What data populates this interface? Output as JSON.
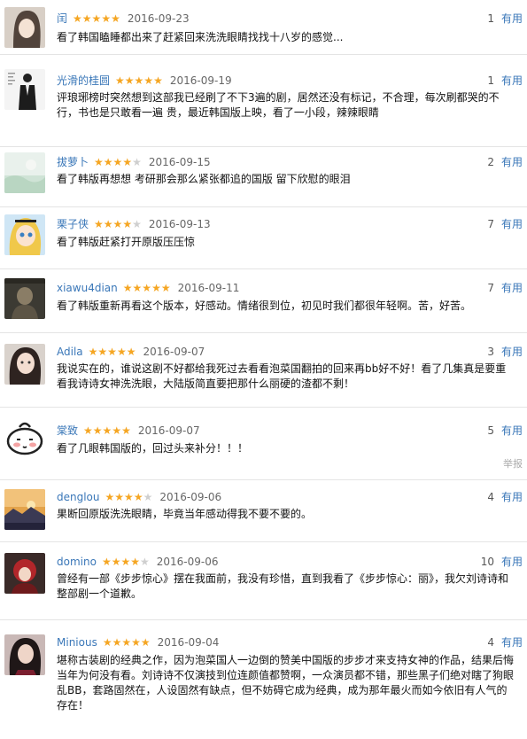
{
  "useful_label": "有用",
  "report_label": "举报",
  "colors": {
    "author_link": "#3a77b8",
    "star_on": "#f5a623",
    "star_off": "#cfcfcf"
  },
  "reviews": [
    {
      "author": "闰",
      "stars": 5,
      "date": "2016-09-23",
      "votes": "1",
      "avatar_icon": "woman-portrait-avatar",
      "text": "看了韩国瞌睡都出来了赶紧回来洗洗眼睛找找十八岁的感觉..."
    },
    {
      "author": "光滑的桂圆",
      "stars": 5,
      "date": "2016-09-19",
      "votes": "1",
      "avatar_icon": "suit-figure-avatar",
      "text": "评琅琊榜时突然想到这部我已经刷了不下3遍的剧，居然还没有标记，不合理，每次刷都哭的不行，书也是只敢看一遍 贵，最近韩国版上映，看了一小段，辣辣眼睛"
    },
    {
      "author": "拔萝卜",
      "stars": 4,
      "date": "2016-09-15",
      "votes": "2",
      "avatar_icon": "pale-scenery-avatar",
      "text": "看了韩版再想想 考研那会那么紧张都追的国版 留下欣慰的眼泪"
    },
    {
      "author": "栗子侠",
      "stars": 4,
      "date": "2016-09-13",
      "votes": "7",
      "avatar_icon": "cartoon-girl-avatar",
      "text": "看了韩版赶紧打开原版压压惊"
    },
    {
      "author": "xiawu4dian",
      "stars": 5,
      "date": "2016-09-11",
      "votes": "7",
      "avatar_icon": "dark-photo-avatar",
      "text": "看了韩版重新再看这个版本，好感动。情绪很到位，初见时我们都很年轻啊。苦，好苦。"
    },
    {
      "author": "Adila",
      "stars": 5,
      "date": "2016-09-07",
      "votes": "3",
      "avatar_icon": "woman-face-avatar",
      "text": "我说实在的，谁说这剧不好都给我死过去看看泡菜国翻拍的回来再bb好不好！看了几集真是要重看我诗诗女神洗洗眼，大陆版简直要把那什么丽硬的渣都不剩！"
    },
    {
      "author": "棠致",
      "stars": 5,
      "date": "2016-09-07",
      "votes": "5",
      "avatar_icon": "blushing-face-avatar",
      "text": "看了几眼韩国版的，回过头来补分！！！",
      "report": true
    },
    {
      "author": "denglou",
      "stars": 4,
      "date": "2016-09-06",
      "votes": "4",
      "avatar_icon": "sunset-scenery-avatar",
      "text": "果断回原版洗洗眼睛，毕竟当年感动得我不要不要的。"
    },
    {
      "author": "domino",
      "stars": 4,
      "date": "2016-09-06",
      "votes": "10",
      "avatar_icon": "red-figure-avatar",
      "text": "曾经有一部《步步惊心》摆在我面前，我没有珍惜，直到我看了《步步惊心：丽》，我欠刘诗诗和整部剧一个道歉。"
    },
    {
      "author": "Minious",
      "stars": 5,
      "date": "2016-09-04",
      "votes": "4",
      "avatar_icon": "woman-dark-avatar",
      "text": "堪称古装剧的经典之作，因为泡菜国人一边倒的赞美中国版的步步才来支持女神的作品，结果后悔当年为何没有看。刘诗诗不仅演技到位连颜值都赞啊，一众演员都不错，那些黑子们绝对瞎了狗眼乱BB，套路固然在，人设固然有缺点，但不妨碍它成为经典，成为那年最火而如今依旧有人气的存在！"
    }
  ]
}
